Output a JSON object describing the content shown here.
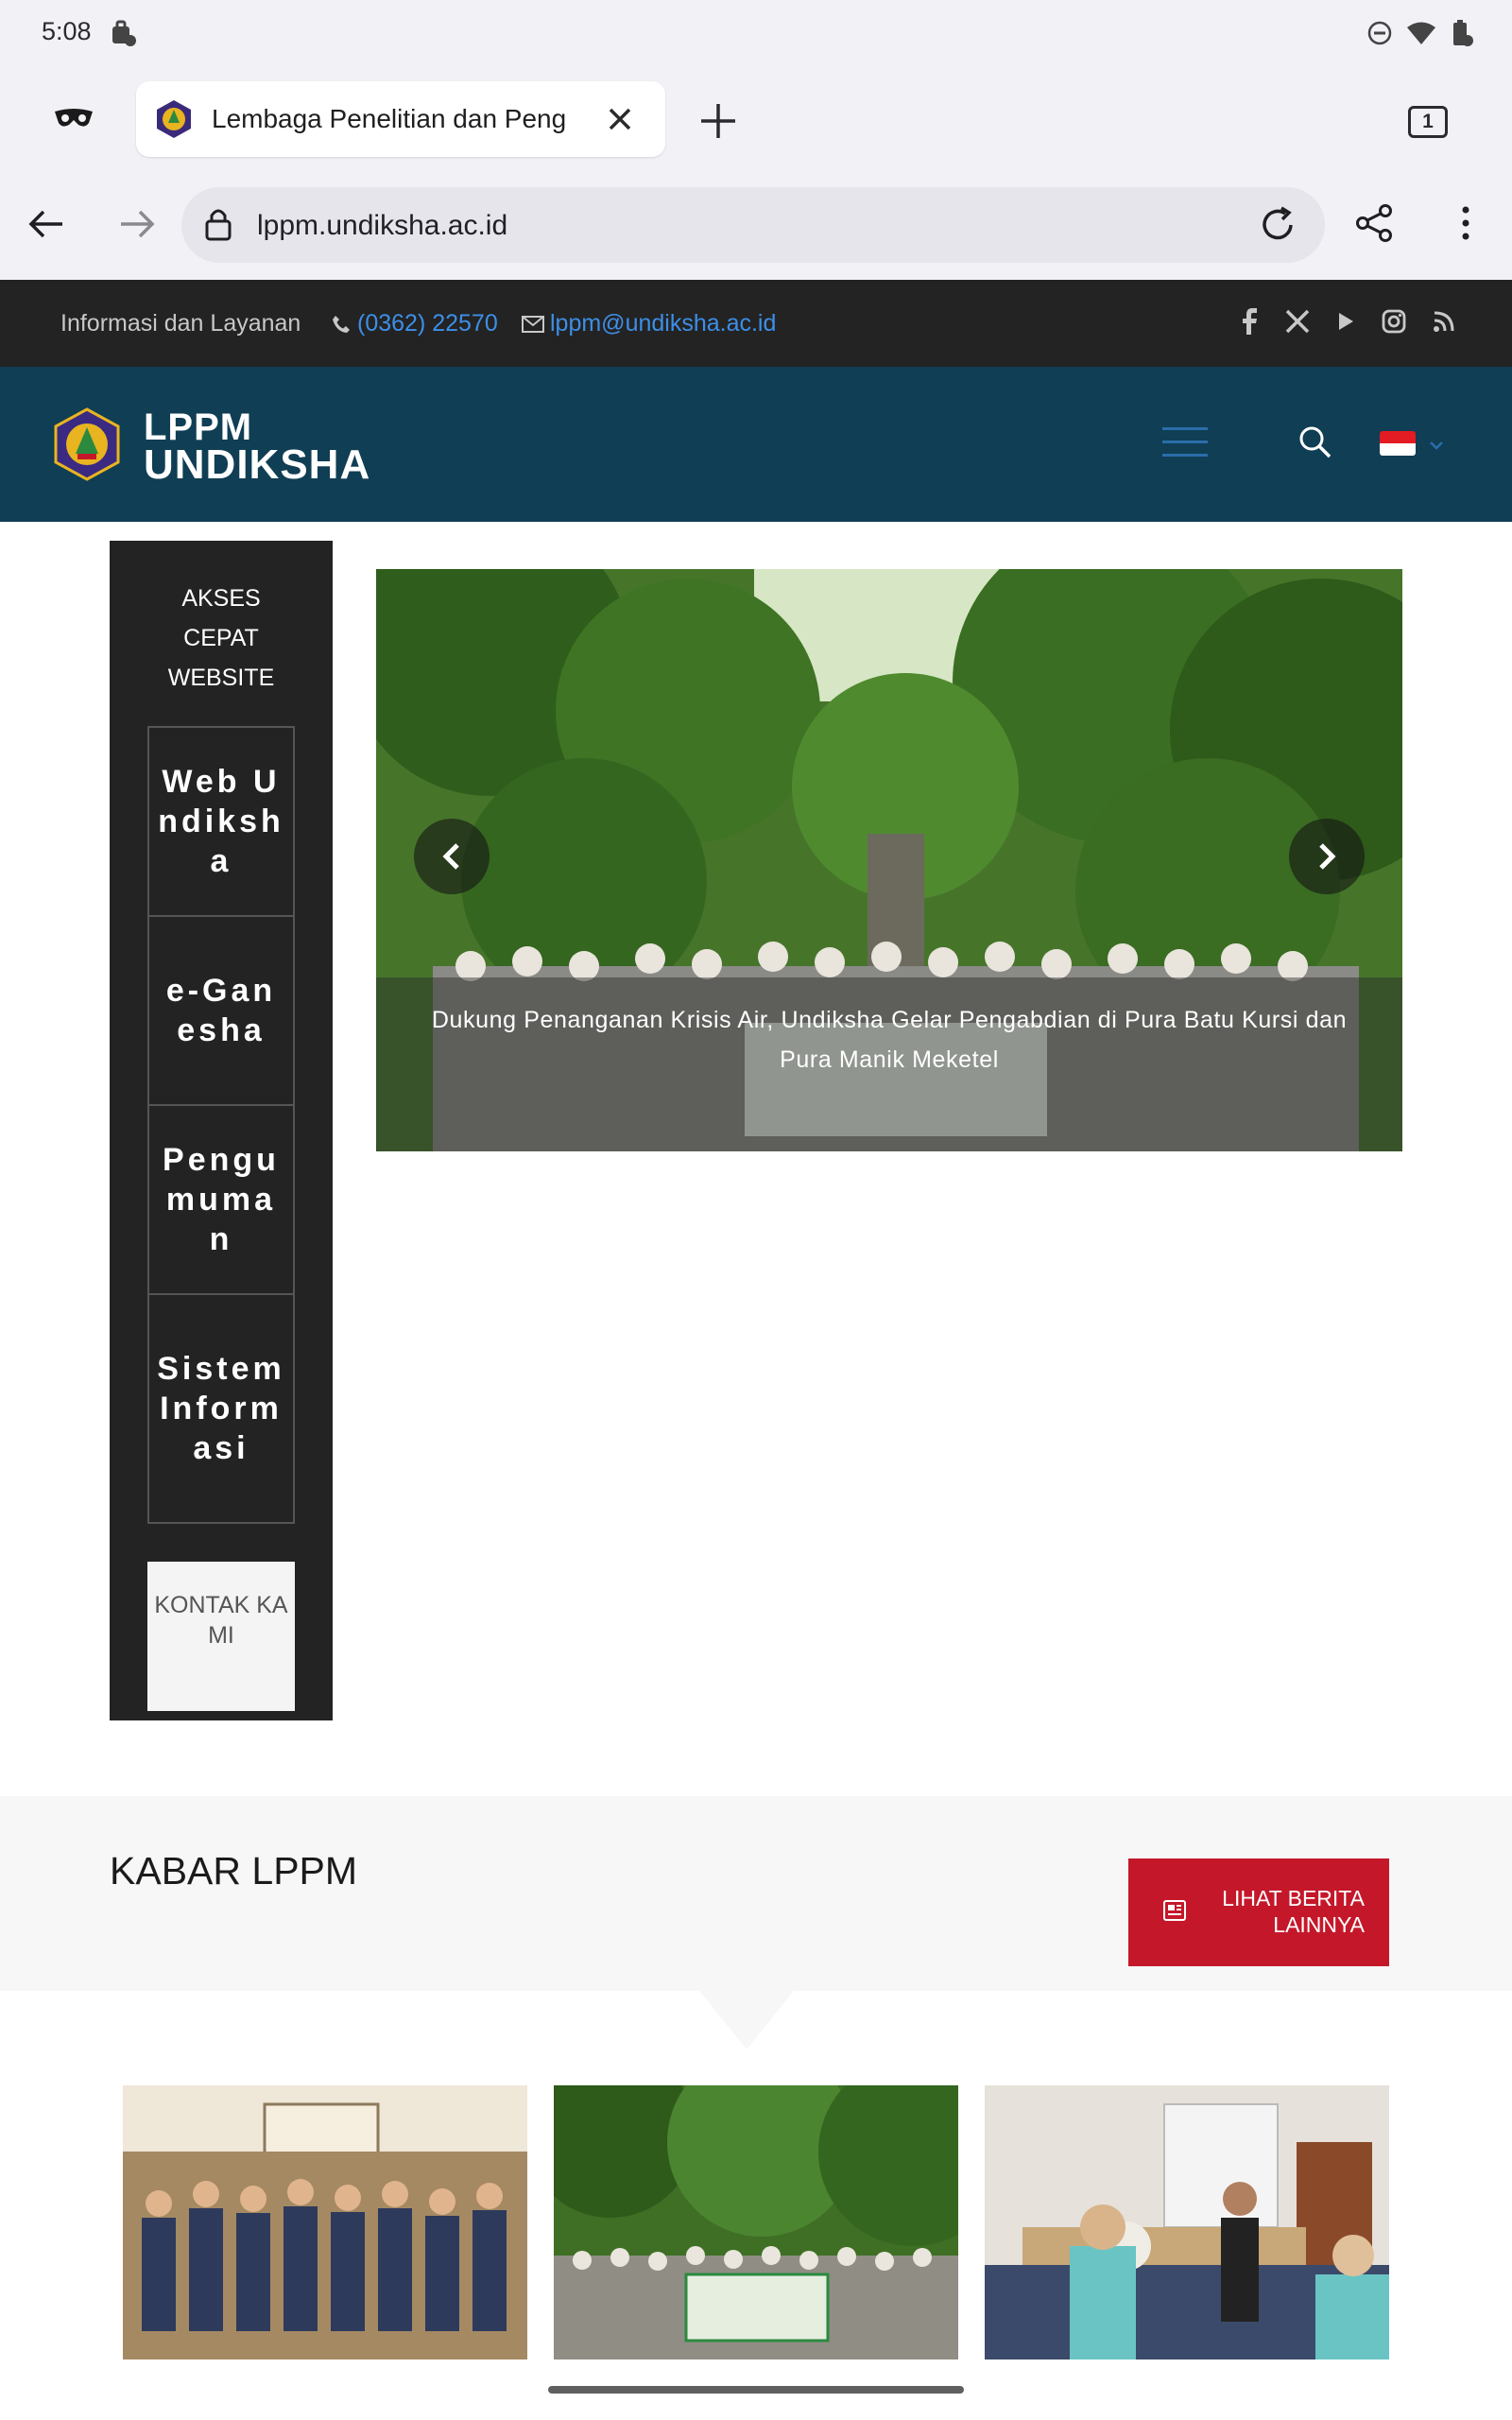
{
  "status_bar": {
    "time": "5:08"
  },
  "browser": {
    "tab_title": "Lembaga Penelitian dan Peng",
    "tab_count": "1",
    "url": "lppm.undiksha.ac.id"
  },
  "info_bar": {
    "label": "Informasi dan Layanan",
    "phone": "(0362) 22570",
    "email": "lppm@undiksha.ac.id",
    "social_icons": [
      "facebook-icon",
      "x-twitter-icon",
      "youtube-icon",
      "instagram-icon",
      "rss-icon"
    ]
  },
  "header": {
    "logo_line1": "LPPM",
    "logo_line2": "UNDIKSHA",
    "brand_color": "#103e54",
    "language_flag": "indonesia-flag-icon"
  },
  "quick_access": {
    "title_lines": [
      "AKSES",
      "CEPAT",
      "WEBSITE"
    ],
    "links": [
      {
        "label": "Web Undiksha"
      },
      {
        "label": "e-Ganesha"
      },
      {
        "label": "Pengumuman"
      },
      {
        "label": "Sistem Informasi"
      }
    ],
    "contact_label": "KONTAK KAMI"
  },
  "slider": {
    "caption": "Dukung Penanganan Krisis Air, Undiksha Gelar Pengabdian di Pura Batu Kursi dan Pura Manik Meketel"
  },
  "news": {
    "heading": "KABAR LPPM",
    "more_button": "LIHAT BERITA LAINNYA",
    "accent_color": "#c4182a"
  }
}
